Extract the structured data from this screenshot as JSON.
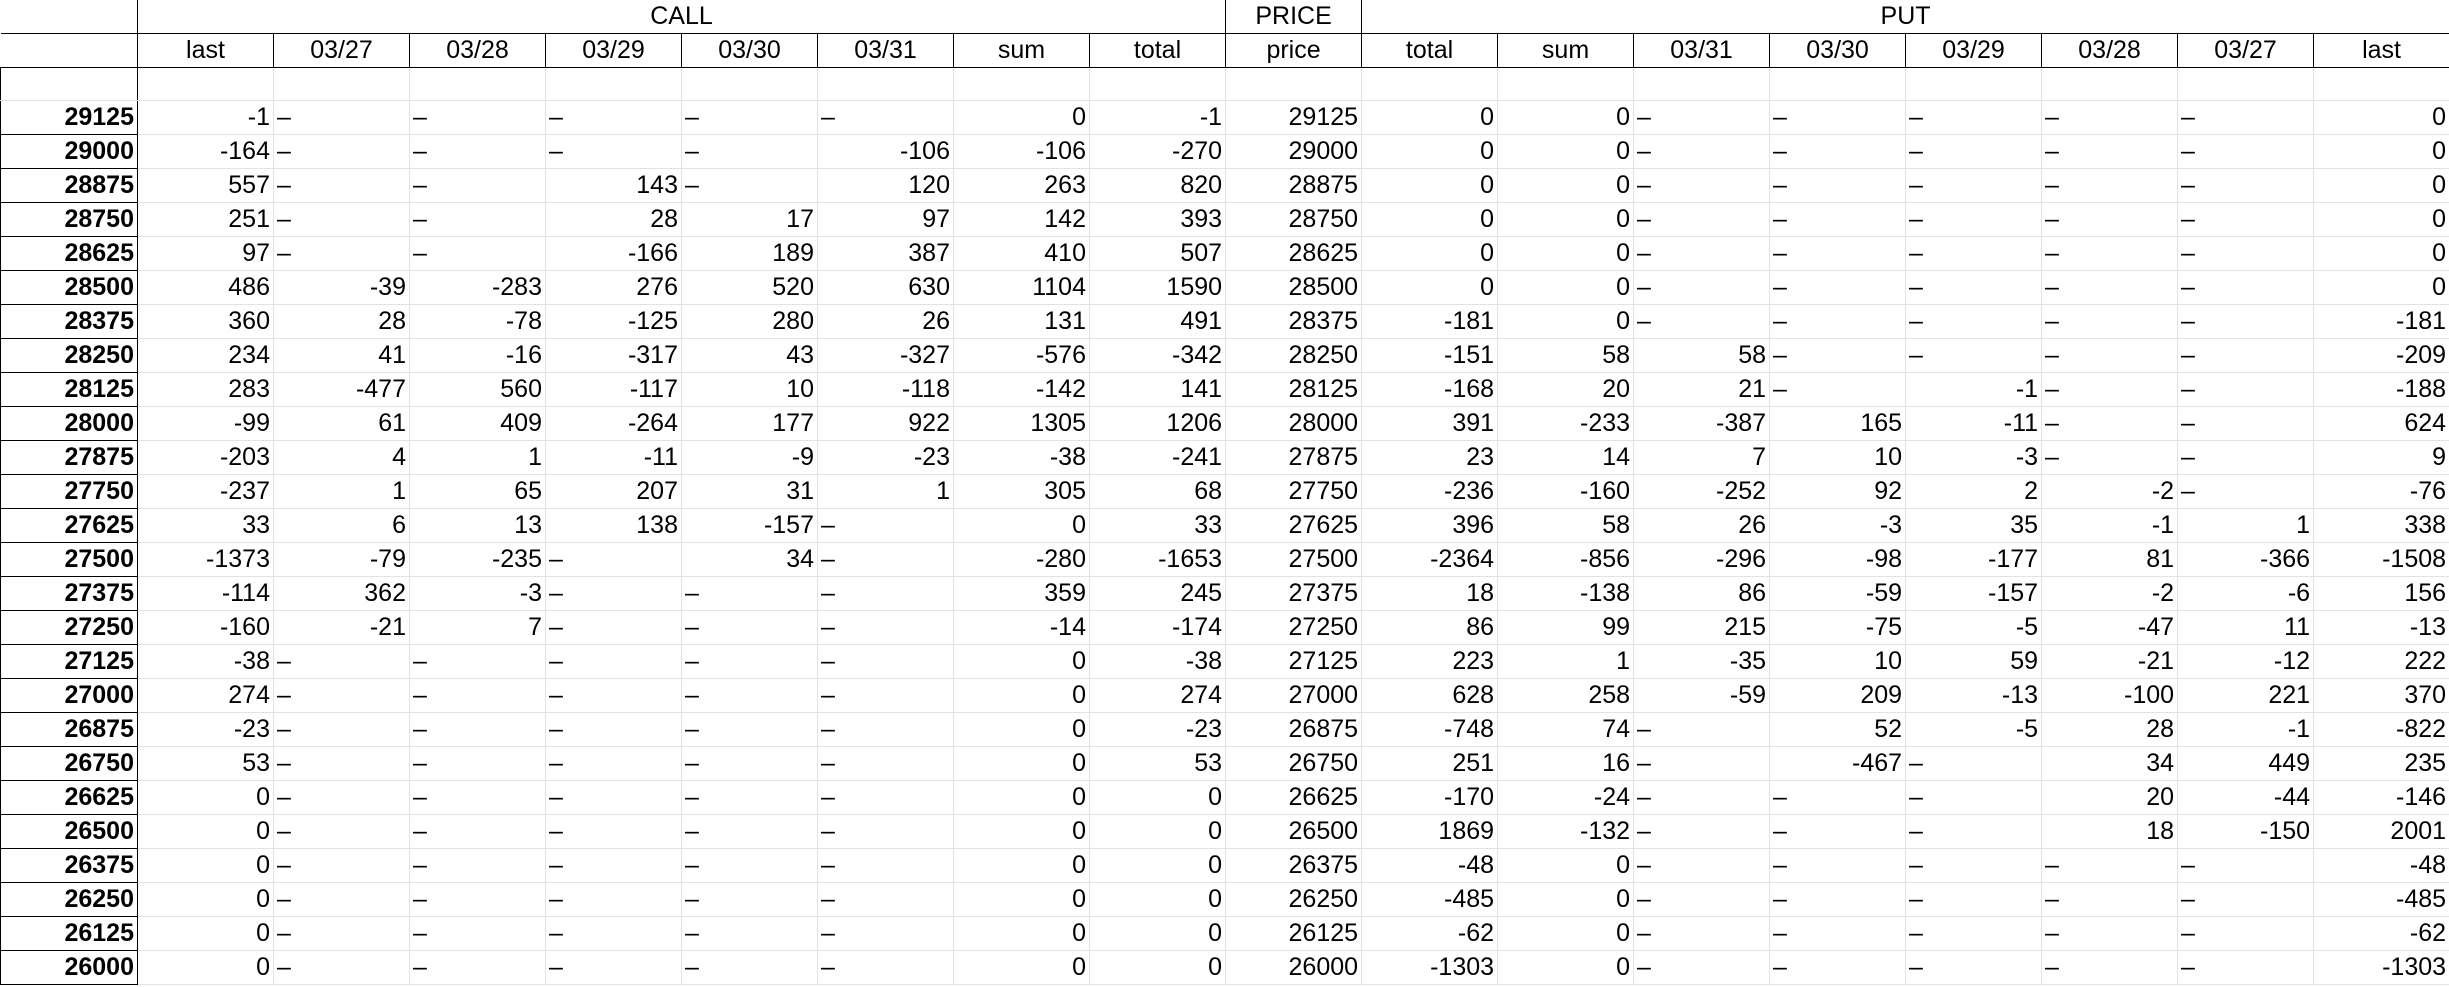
{
  "groups": {
    "call": "CALL",
    "price": "PRICE",
    "put": "PUT"
  },
  "columns": [
    "last",
    "03/27",
    "03/28",
    "03/29",
    "03/30",
    "03/31",
    "sum",
    "total",
    "price",
    "total",
    "sum",
    "03/31",
    "03/30",
    "03/29",
    "03/28",
    "03/27",
    "last"
  ],
  "rows": [
    {
      "strike": "29125",
      "cells": [
        "-1",
        "–",
        "–",
        "–",
        "–",
        "–",
        "0",
        "-1",
        "29125",
        "0",
        "0",
        "–",
        "–",
        "–",
        "–",
        "–",
        "0"
      ]
    },
    {
      "strike": "29000",
      "cells": [
        "-164",
        "–",
        "–",
        "–",
        "–",
        "-106",
        "-106",
        "-270",
        "29000",
        "0",
        "0",
        "–",
        "–",
        "–",
        "–",
        "–",
        "0"
      ]
    },
    {
      "strike": "28875",
      "cells": [
        "557",
        "–",
        "–",
        "143",
        "–",
        "120",
        "263",
        "820",
        "28875",
        "0",
        "0",
        "–",
        "–",
        "–",
        "–",
        "–",
        "0"
      ]
    },
    {
      "strike": "28750",
      "cells": [
        "251",
        "–",
        "–",
        "28",
        "17",
        "97",
        "142",
        "393",
        "28750",
        "0",
        "0",
        "–",
        "–",
        "–",
        "–",
        "–",
        "0"
      ]
    },
    {
      "strike": "28625",
      "cells": [
        "97",
        "–",
        "–",
        "-166",
        "189",
        "387",
        "410",
        "507",
        "28625",
        "0",
        "0",
        "–",
        "–",
        "–",
        "–",
        "–",
        "0"
      ]
    },
    {
      "strike": "28500",
      "cells": [
        "486",
        "-39",
        "-283",
        "276",
        "520",
        "630",
        "1104",
        "1590",
        "28500",
        "0",
        "0",
        "–",
        "–",
        "–",
        "–",
        "–",
        "0"
      ]
    },
    {
      "strike": "28375",
      "cells": [
        "360",
        "28",
        "-78",
        "-125",
        "280",
        "26",
        "131",
        "491",
        "28375",
        "-181",
        "0",
        "–",
        "–",
        "–",
        "–",
        "–",
        "-181"
      ]
    },
    {
      "strike": "28250",
      "cells": [
        "234",
        "41",
        "-16",
        "-317",
        "43",
        "-327",
        "-576",
        "-342",
        "28250",
        "-151",
        "58",
        "58",
        "–",
        "–",
        "–",
        "–",
        "-209"
      ]
    },
    {
      "strike": "28125",
      "cells": [
        "283",
        "-477",
        "560",
        "-117",
        "10",
        "-118",
        "-142",
        "141",
        "28125",
        "-168",
        "20",
        "21",
        "–",
        "-1",
        "–",
        "–",
        "-188"
      ]
    },
    {
      "strike": "28000",
      "cells": [
        "-99",
        "61",
        "409",
        "-264",
        "177",
        "922",
        "1305",
        "1206",
        "28000",
        "391",
        "-233",
        "-387",
        "165",
        "-11",
        "–",
        "–",
        "624"
      ]
    },
    {
      "strike": "27875",
      "cells": [
        "-203",
        "4",
        "1",
        "-11",
        "-9",
        "-23",
        "-38",
        "-241",
        "27875",
        "23",
        "14",
        "7",
        "10",
        "-3",
        "–",
        "–",
        "9"
      ]
    },
    {
      "strike": "27750",
      "cells": [
        "-237",
        "1",
        "65",
        "207",
        "31",
        "1",
        "305",
        "68",
        "27750",
        "-236",
        "-160",
        "-252",
        "92",
        "2",
        "-2",
        "–",
        "-76"
      ]
    },
    {
      "strike": "27625",
      "cells": [
        "33",
        "6",
        "13",
        "138",
        "-157",
        "–",
        "0",
        "33",
        "27625",
        "396",
        "58",
        "26",
        "-3",
        "35",
        "-1",
        "1",
        "338"
      ]
    },
    {
      "strike": "27500",
      "cells": [
        "-1373",
        "-79",
        "-235",
        "–",
        "34",
        "–",
        "-280",
        "-1653",
        "27500",
        "-2364",
        "-856",
        "-296",
        "-98",
        "-177",
        "81",
        "-366",
        "-1508"
      ]
    },
    {
      "strike": "27375",
      "cells": [
        "-114",
        "362",
        "-3",
        "–",
        "–",
        "–",
        "359",
        "245",
        "27375",
        "18",
        "-138",
        "86",
        "-59",
        "-157",
        "-2",
        "-6",
        "156"
      ]
    },
    {
      "strike": "27250",
      "cells": [
        "-160",
        "-21",
        "7",
        "–",
        "–",
        "–",
        "-14",
        "-174",
        "27250",
        "86",
        "99",
        "215",
        "-75",
        "-5",
        "-47",
        "11",
        "-13"
      ]
    },
    {
      "strike": "27125",
      "cells": [
        "-38",
        "–",
        "–",
        "–",
        "–",
        "–",
        "0",
        "-38",
        "27125",
        "223",
        "1",
        "-35",
        "10",
        "59",
        "-21",
        "-12",
        "222"
      ]
    },
    {
      "strike": "27000",
      "cells": [
        "274",
        "–",
        "–",
        "–",
        "–",
        "–",
        "0",
        "274",
        "27000",
        "628",
        "258",
        "-59",
        "209",
        "-13",
        "-100",
        "221",
        "370"
      ]
    },
    {
      "strike": "26875",
      "cells": [
        "-23",
        "–",
        "–",
        "–",
        "–",
        "–",
        "0",
        "-23",
        "26875",
        "-748",
        "74",
        "–",
        "52",
        "-5",
        "28",
        "-1",
        "-822"
      ]
    },
    {
      "strike": "26750",
      "cells": [
        "53",
        "–",
        "–",
        "–",
        "–",
        "–",
        "0",
        "53",
        "26750",
        "251",
        "16",
        "–",
        "-467",
        "–",
        "34",
        "449",
        "235"
      ]
    },
    {
      "strike": "26625",
      "cells": [
        "0",
        "–",
        "–",
        "–",
        "–",
        "–",
        "0",
        "0",
        "26625",
        "-170",
        "-24",
        "–",
        "–",
        "–",
        "20",
        "-44",
        "-146"
      ]
    },
    {
      "strike": "26500",
      "cells": [
        "0",
        "–",
        "–",
        "–",
        "–",
        "–",
        "0",
        "0",
        "26500",
        "1869",
        "-132",
        "–",
        "–",
        "–",
        "18",
        "-150",
        "2001"
      ]
    },
    {
      "strike": "26375",
      "cells": [
        "0",
        "–",
        "–",
        "–",
        "–",
        "–",
        "0",
        "0",
        "26375",
        "-48",
        "0",
        "–",
        "–",
        "–",
        "–",
        "–",
        "-48"
      ]
    },
    {
      "strike": "26250",
      "cells": [
        "0",
        "–",
        "–",
        "–",
        "–",
        "–",
        "0",
        "0",
        "26250",
        "-485",
        "0",
        "–",
        "–",
        "–",
        "–",
        "–",
        "-485"
      ]
    },
    {
      "strike": "26125",
      "cells": [
        "0",
        "–",
        "–",
        "–",
        "–",
        "–",
        "0",
        "0",
        "26125",
        "-62",
        "0",
        "–",
        "–",
        "–",
        "–",
        "–",
        "-62"
      ]
    },
    {
      "strike": "26000",
      "cells": [
        "0",
        "–",
        "–",
        "–",
        "–",
        "–",
        "0",
        "0",
        "26000",
        "-1303",
        "0",
        "–",
        "–",
        "–",
        "–",
        "–",
        "-1303"
      ]
    }
  ]
}
